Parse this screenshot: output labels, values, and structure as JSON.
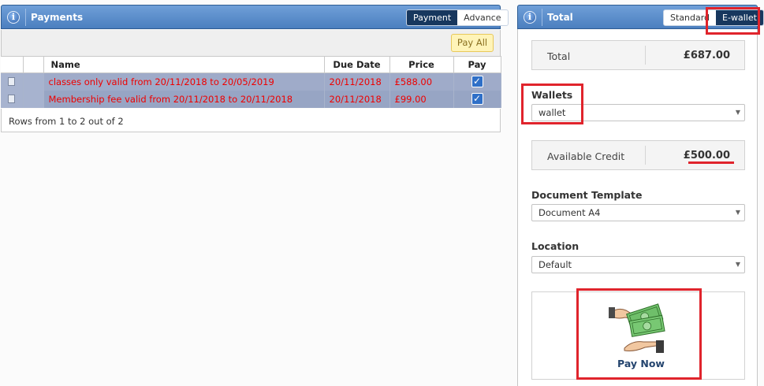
{
  "payments_panel": {
    "title": "Payments",
    "toggle": [
      {
        "label": "Payment",
        "active": true
      },
      {
        "label": "Advance",
        "active": false
      }
    ],
    "pay_all_label": "Pay All",
    "columns": [
      "Name",
      "Due Date",
      "Price",
      "Pay"
    ],
    "rows": [
      {
        "name": "classes only valid from 20/11/2018 to 20/05/2019",
        "due_date": "20/11/2018",
        "price": "£588.00",
        "pay": true
      },
      {
        "name": "Membership fee valid from 20/11/2018 to 20/11/2018",
        "due_date": "20/11/2018",
        "price": "£99.00",
        "pay": true
      }
    ],
    "footer": "Rows from 1 to 2 out of 2"
  },
  "total_panel": {
    "title": "Total",
    "toggle": [
      {
        "label": "Standard",
        "active": false
      },
      {
        "label": "E-wallet",
        "active": true
      }
    ],
    "total_label": "Total",
    "total_value": "£687.00",
    "wallets_label": "Wallets",
    "wallets_value": "wallet",
    "available_credit_label": "Available Credit",
    "available_credit_value": "£500.00",
    "document_template_label": "Document Template",
    "document_template_value": "Document A4",
    "location_label": "Location",
    "location_value": "Default",
    "pay_now_label": "Pay Now"
  },
  "colors": {
    "header_blue": "#4b7fbf",
    "active_toggle": "#17375e",
    "row_text_red": "#ee0000",
    "highlight_red": "#e0242c"
  }
}
